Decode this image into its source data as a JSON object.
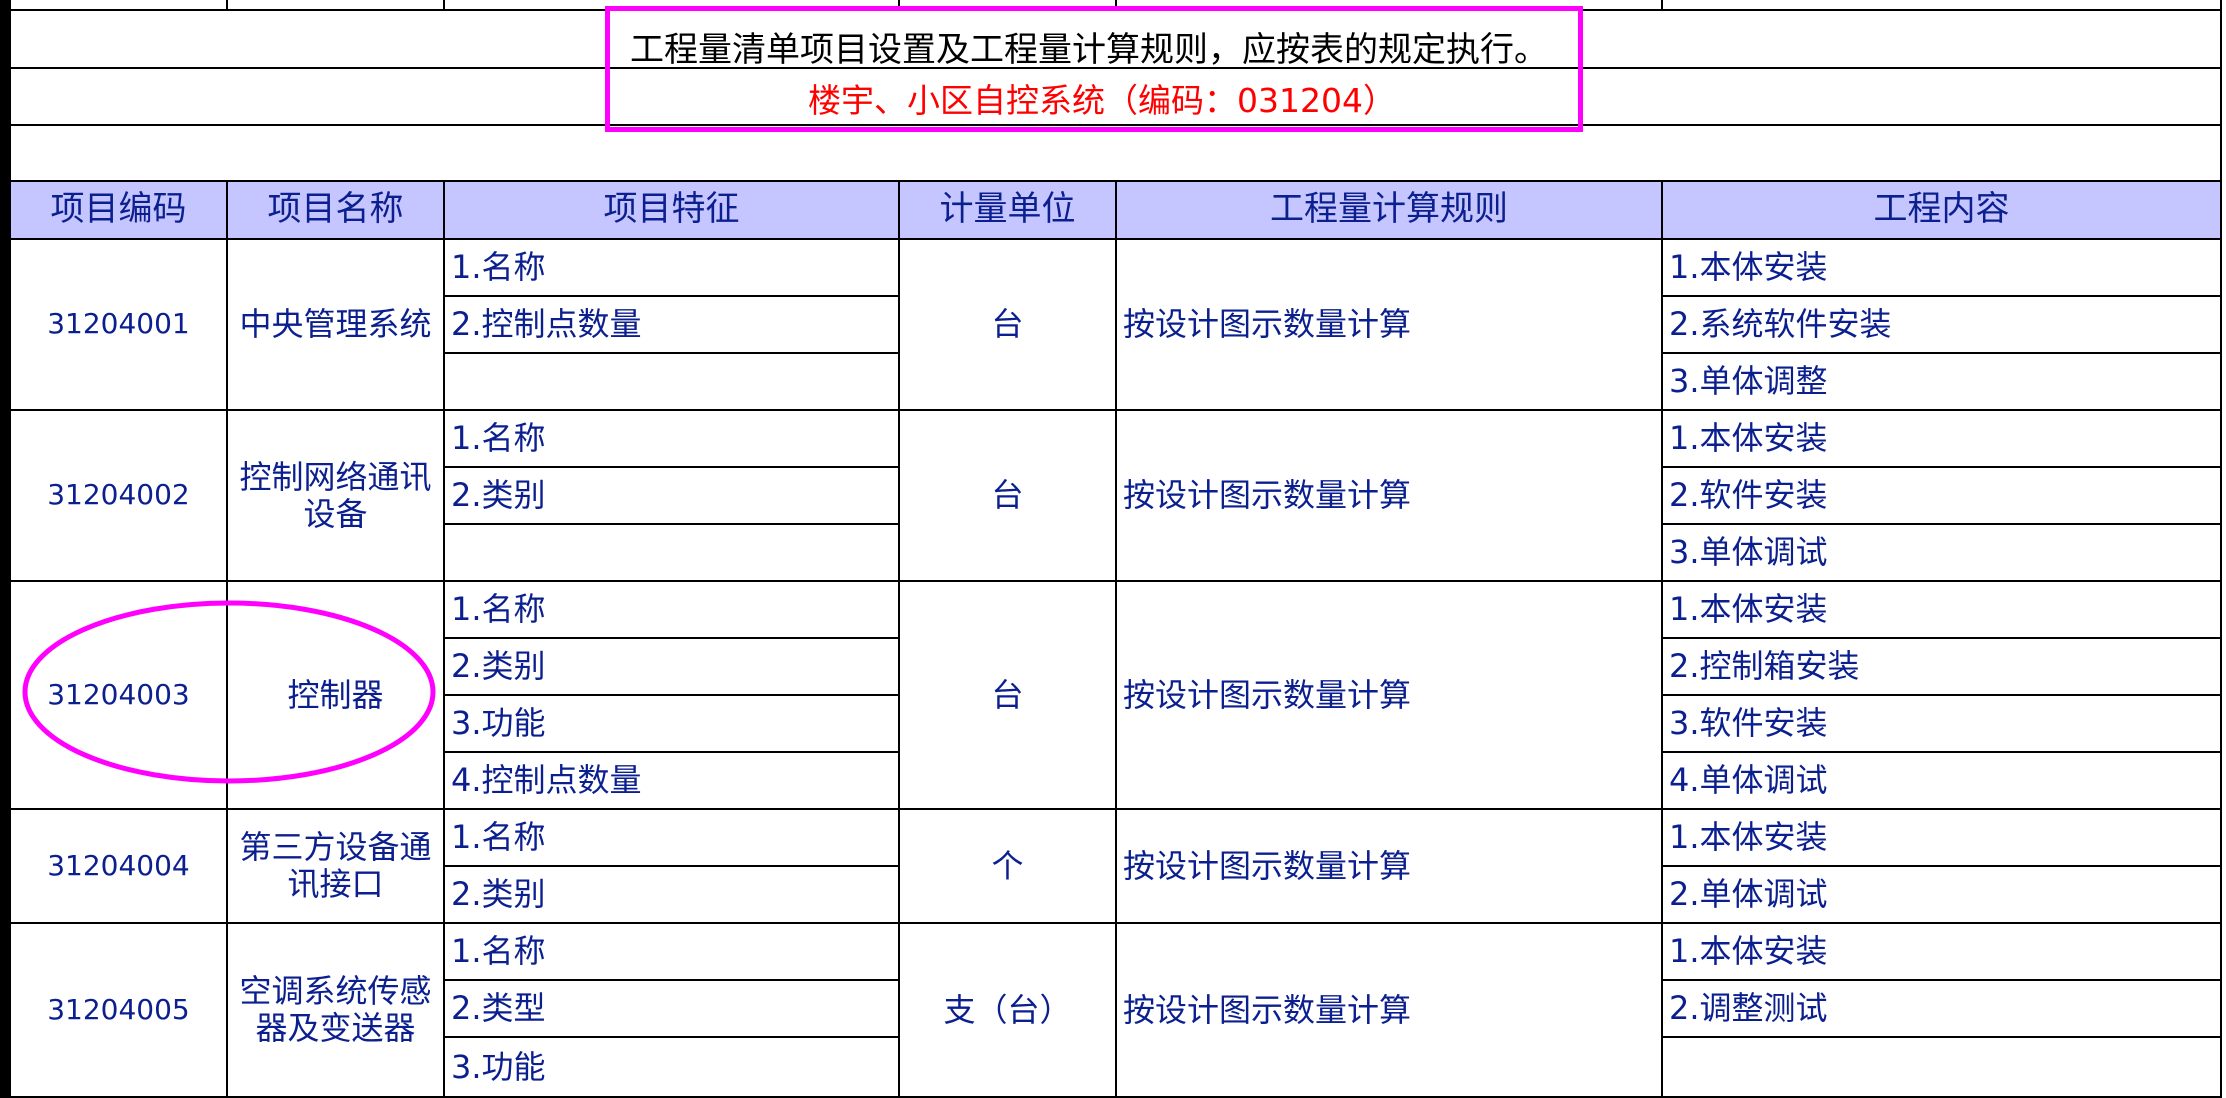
{
  "notice": {
    "line1": "工程量清单项目设置及工程量计算规则，应按表的规定执行。",
    "line2": "楼宇、小区自控系统（编码：031204）"
  },
  "table": {
    "headers": [
      "项目编码",
      "项目名称",
      "项目特征",
      "计量单位",
      "工程量计算规则",
      "工程内容"
    ],
    "rows": [
      {
        "code": "31204001",
        "name": "中央管理系统",
        "features": [
          "1.名称",
          "2.控制点数量",
          ""
        ],
        "unit": "台",
        "rule": "按设计图示数量计算",
        "content": [
          "1.本体安装",
          "2.系统软件安装",
          "3.单体调整"
        ]
      },
      {
        "code": "31204002",
        "name": "控制网络通讯 设备",
        "features": [
          "1.名称",
          "2.类别",
          ""
        ],
        "unit": "台",
        "rule": "按设计图示数量计算",
        "content": [
          "1.本体安装",
          "2.软件安装",
          "3.单体调试"
        ]
      },
      {
        "code": "31204003",
        "name": "控制器",
        "features": [
          "1.名称",
          "2.类别",
          "3.功能",
          "4.控制点数量"
        ],
        "unit": "台",
        "rule": "按设计图示数量计算",
        "content": [
          "1.本体安装",
          "2.控制箱安装",
          "3.软件安装",
          "4.单体调试"
        ]
      },
      {
        "code": "31204004",
        "name": "第三方设备通讯接口",
        "features": [
          "1.名称",
          "2.类别"
        ],
        "unit": "个",
        "rule": "按设计图示数量计算",
        "content": [
          "1.本体安装",
          "2.单体调试"
        ]
      },
      {
        "code": "31204005",
        "name": "空调系统传感器及变送器",
        "features": [
          "1.名称",
          "2.类型",
          "3.功能"
        ],
        "unit": "支（台）",
        "rule": "按设计图示数量计算",
        "content": [
          "1.本体安装",
          "2.调整测试",
          ""
        ]
      }
    ]
  },
  "annotations": {
    "box_color": "#ff00ff",
    "ellipse_color": "#ff00ff",
    "header_bg": "#c5c5ff",
    "text_color": "#0b1f8f",
    "title_color": "#ff0000"
  }
}
